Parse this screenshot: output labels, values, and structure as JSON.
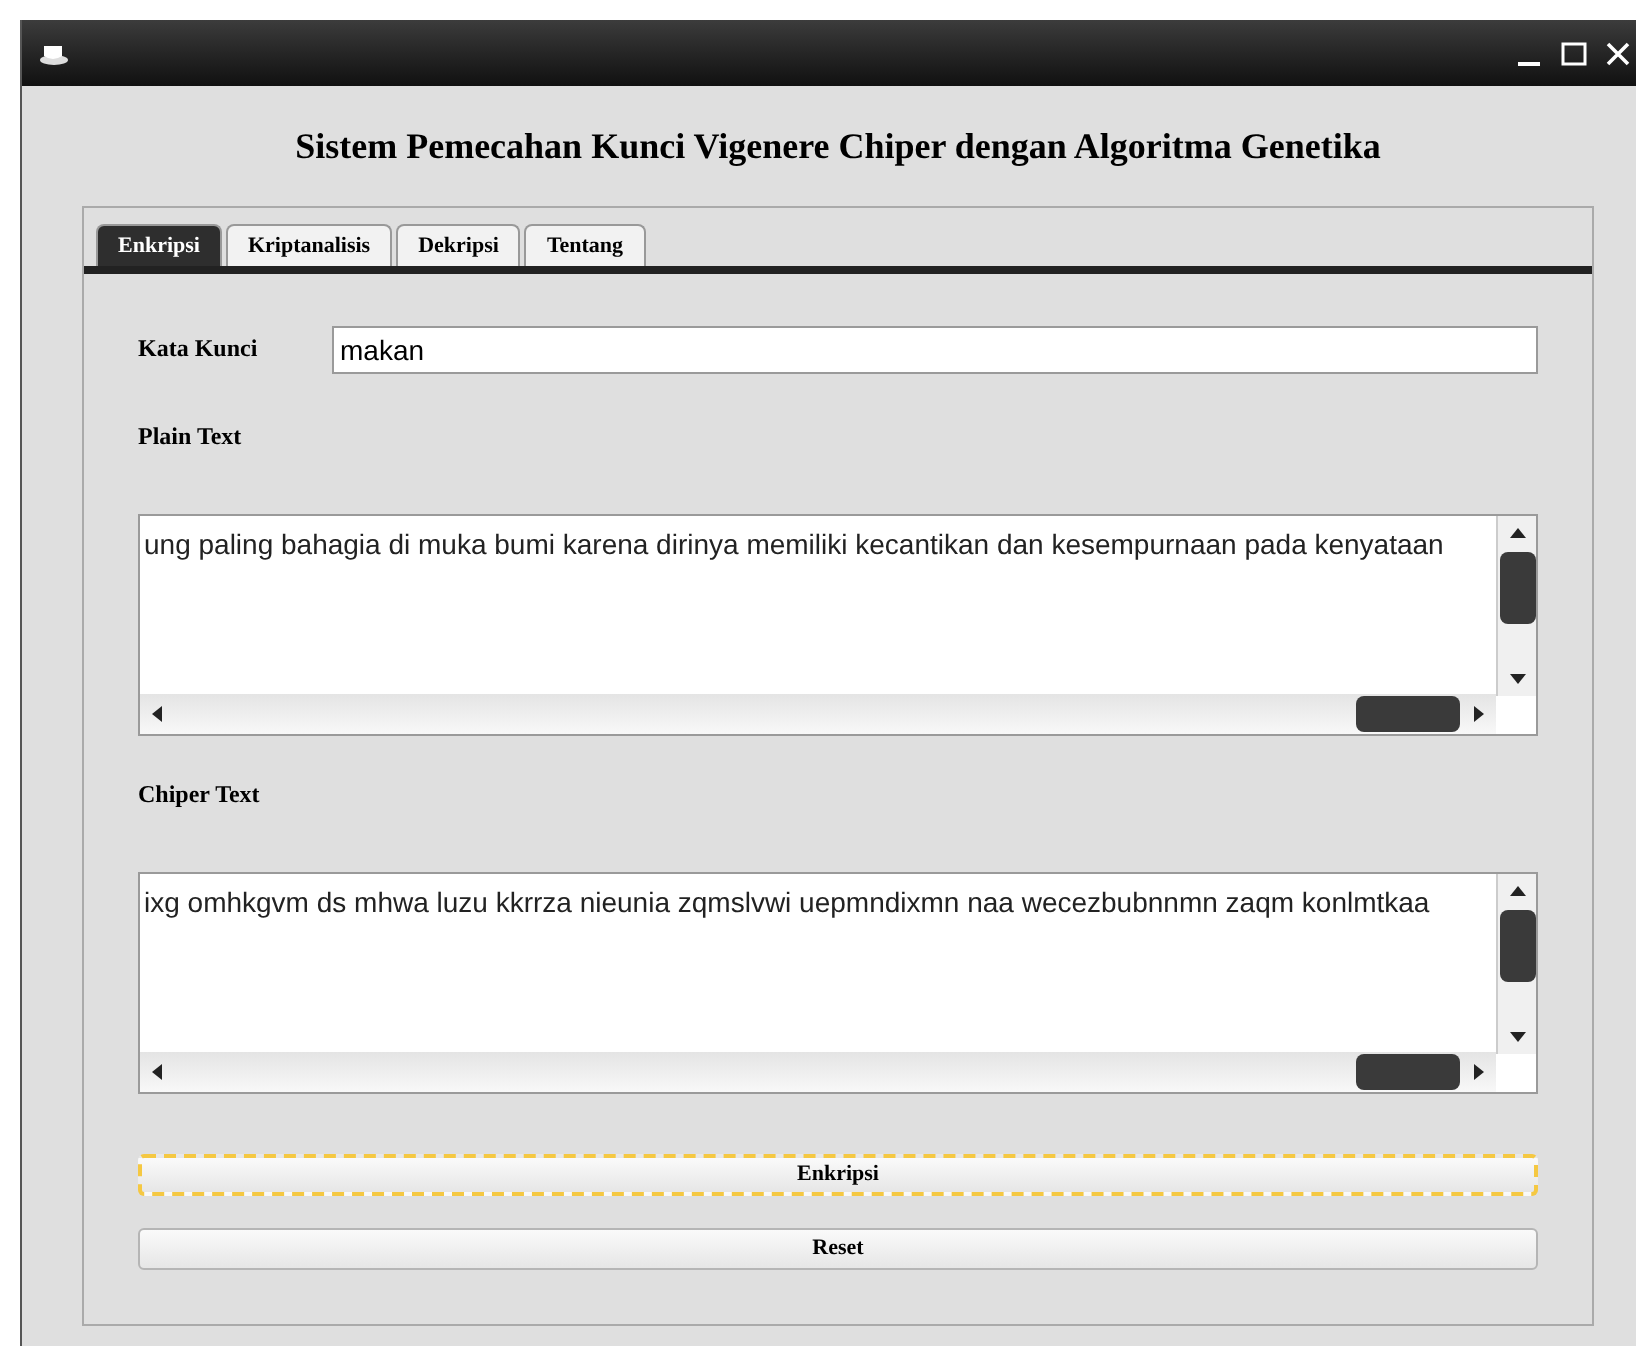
{
  "window": {
    "heading": "Sistem Pemecahan Kunci Vigenere Chiper dengan Algoritma Genetika"
  },
  "tabs": [
    {
      "label": "Enkripsi",
      "selected": true
    },
    {
      "label": "Kriptanalisis",
      "selected": false
    },
    {
      "label": "Dekripsi",
      "selected": false
    },
    {
      "label": "Tentang",
      "selected": false
    }
  ],
  "key_field": {
    "label": "Kata Kunci",
    "value": "makan"
  },
  "plain_text": {
    "label": "Plain Text",
    "value": "ung paling bahagia di muka bumi karena dirinya memiliki kecantikan dan kesempurnaan pada kenyataan"
  },
  "cipher_text": {
    "label": "Chiper Text",
    "value": "ixg omhkgvm ds mhwa luzu kkrrza nieunia zqmslvwi uepmndixmn naa wecezbubnnmn zaqm konlmtkaa"
  },
  "buttons": [
    {
      "label": "Enkripsi",
      "focused": true
    },
    {
      "label": "Reset",
      "focused": false
    }
  ]
}
